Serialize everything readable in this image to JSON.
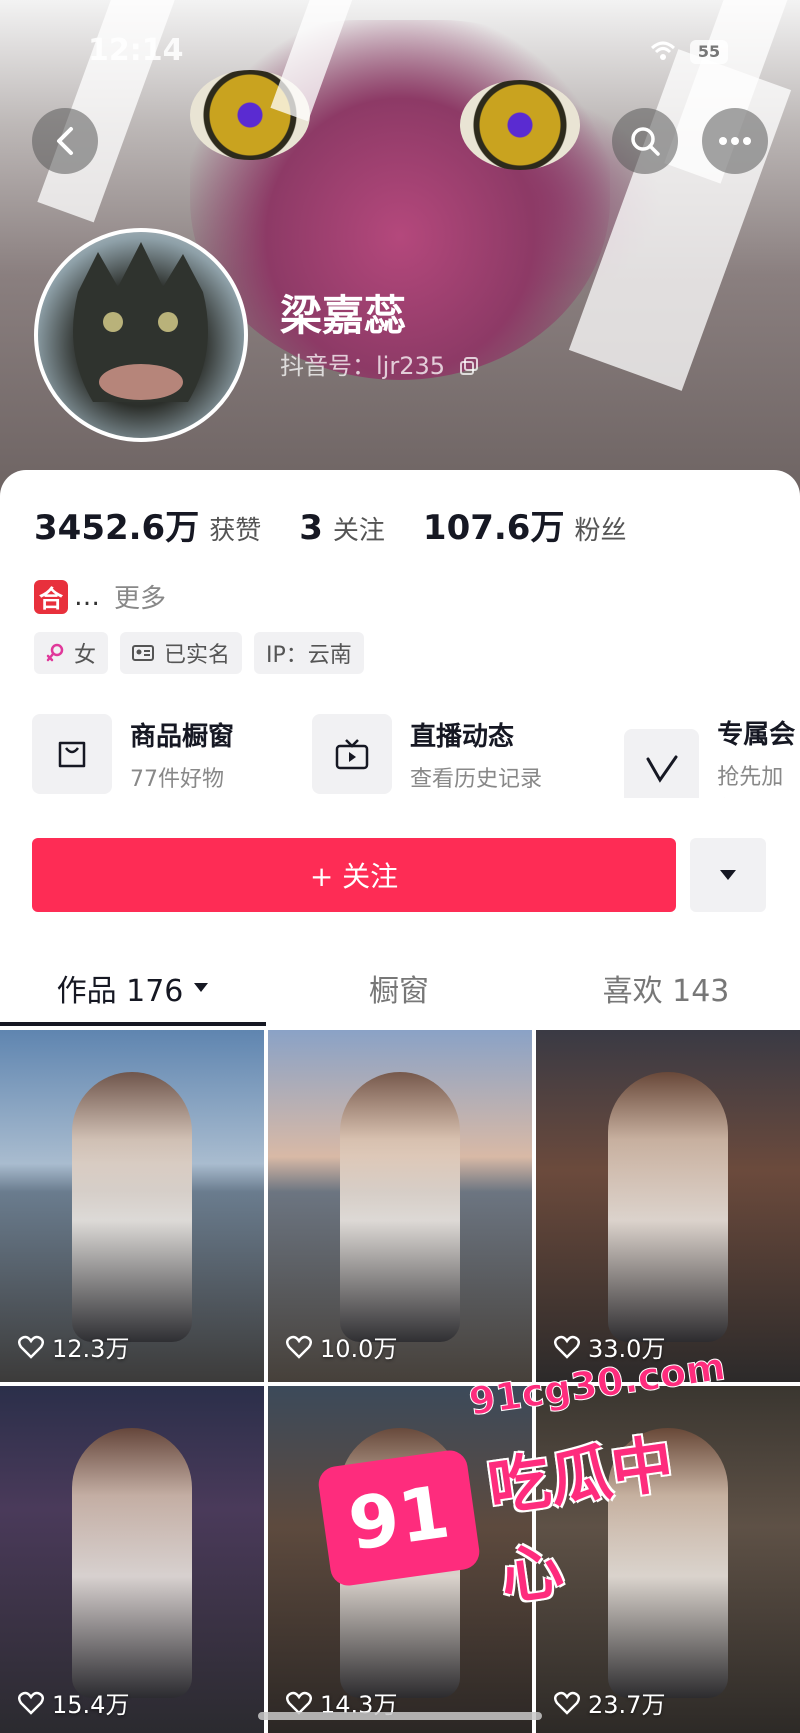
{
  "status_bar": {
    "time": "12:14",
    "battery": "55"
  },
  "profile": {
    "name": "梁嘉蕊",
    "douyin_id": "抖音号：ljr235"
  },
  "stats": [
    {
      "value": "3452.6万",
      "label": "获赞"
    },
    {
      "value": "3",
      "label": "关注"
    },
    {
      "value": "107.6万",
      "label": "粉丝"
    }
  ],
  "bio": {
    "badge": "合",
    "text": "…",
    "more": "更多"
  },
  "tags": {
    "gender": "女",
    "verified": "已实名",
    "ip": "IP：云南"
  },
  "features": [
    {
      "title": "商品橱窗",
      "subtitle": "77件好物",
      "icon": "shopping-bag-icon"
    },
    {
      "title": "直播动态",
      "subtitle": "查看历史记录",
      "icon": "tv-icon"
    },
    {
      "title": "专属会",
      "subtitle": "抢先加入",
      "icon": "v-icon"
    }
  ],
  "actions": {
    "follow": "+ 关注"
  },
  "tabs": [
    {
      "label": "作品 176",
      "active": true
    },
    {
      "label": "橱窗",
      "active": false
    },
    {
      "label": "喜欢 143",
      "active": false
    }
  ],
  "videos": [
    {
      "likes": "12.3万"
    },
    {
      "likes": "10.0万"
    },
    {
      "likes": "33.0万"
    },
    {
      "likes": "15.4万"
    },
    {
      "likes": "14.3万"
    },
    {
      "likes": "23.7万"
    }
  ],
  "watermark": {
    "number": "91",
    "url": "91cg30.com",
    "text": "吃瓜中心"
  },
  "colors": {
    "accent": "#fe2c55",
    "text": "#161823",
    "watermark": "#fe2c7d"
  }
}
